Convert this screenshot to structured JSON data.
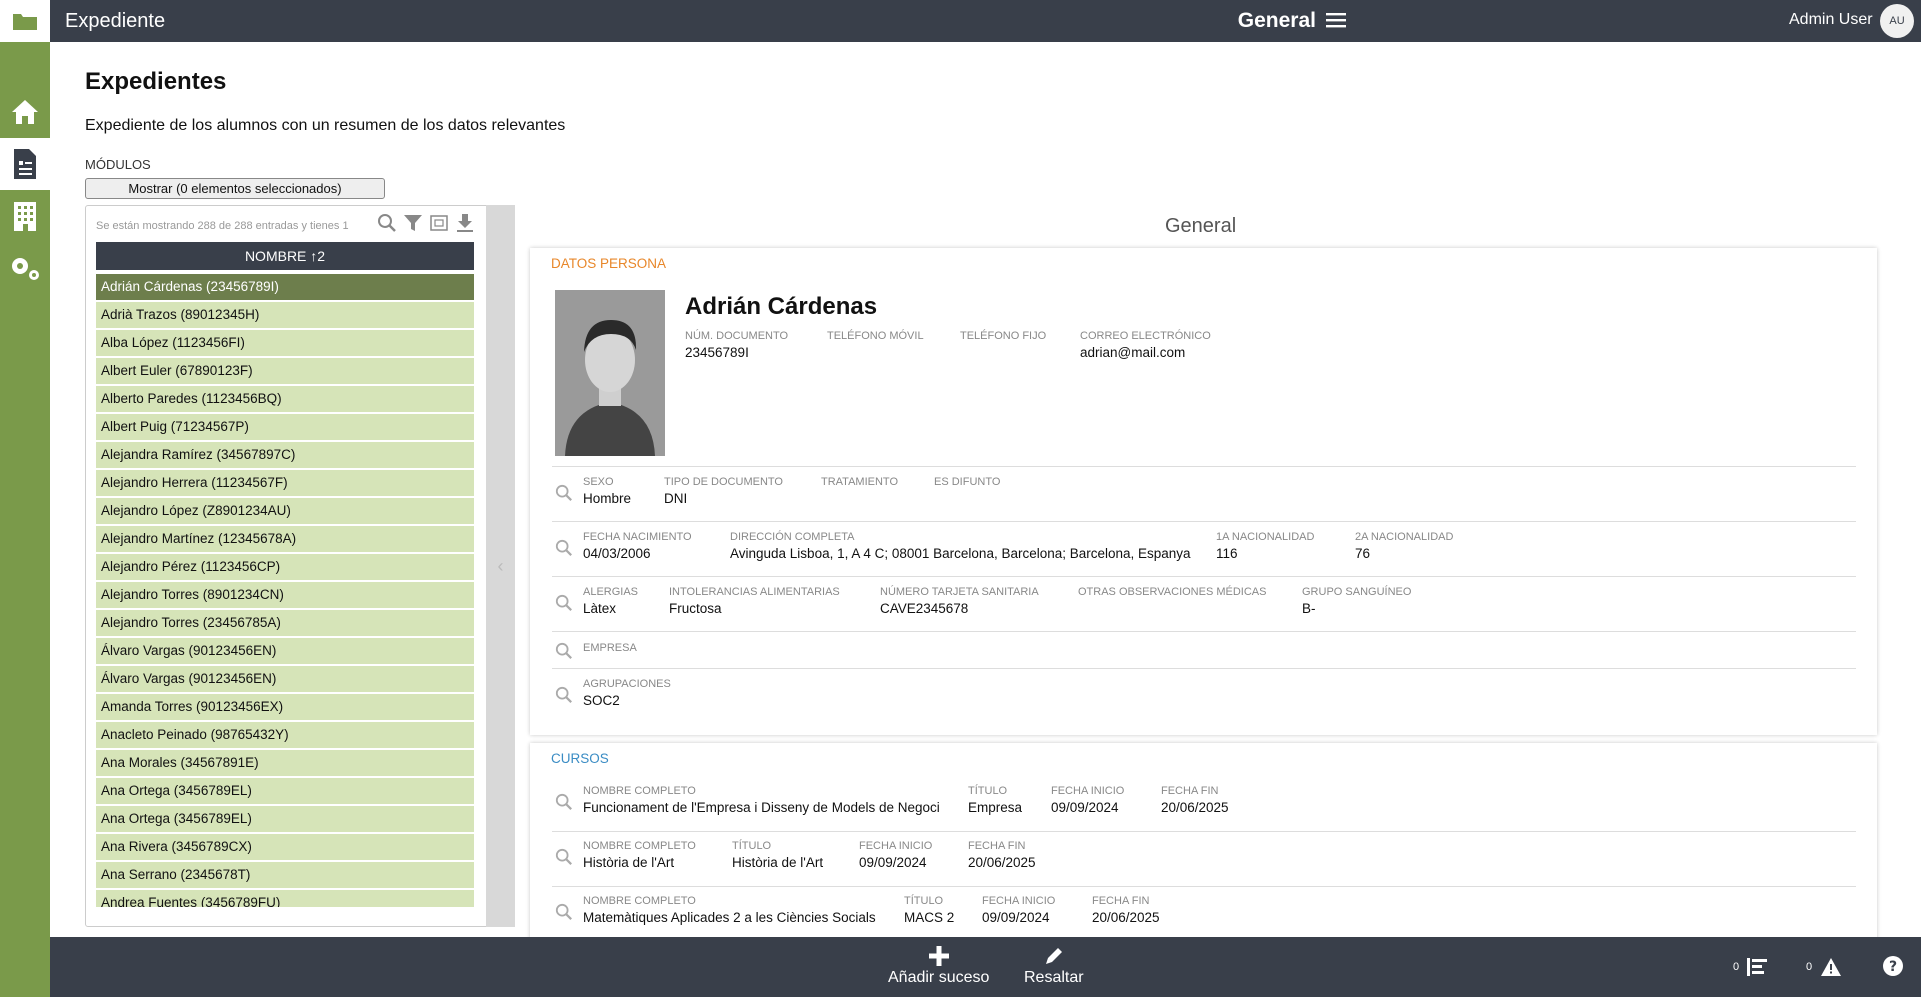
{
  "topbar": {
    "app_title": "Expediente",
    "section": "General",
    "user_name": "Admin User",
    "user_initials": "AU"
  },
  "page": {
    "title": "Expedientes",
    "description": "Expediente de los alumnos con un resumen de los datos relevantes",
    "modules_label": "MÓDULOS",
    "modules_button": "Mostrar (0 elementos seleccionados)"
  },
  "list": {
    "info": "Se están mostrando 288 de 288 entradas y tienes 1",
    "column_header": "NOMBRE ↑2",
    "rows": [
      "Adrián Cárdenas (23456789I)",
      "Adrià Trazos (89012345H)",
      "Alba López (1123456FI)",
      "Albert Euler (67890123F)",
      "Alberto Paredes (1123456BQ)",
      "Albert Puig (71234567P)",
      "Alejandra Ramírez (34567897C)",
      "Alejandro Herrera (11234567F)",
      "Alejandro López (Z8901234AU)",
      "Alejandro Martínez (12345678A)",
      "Alejandro Pérez (1123456CP)",
      "Alejandro Torres (8901234CN)",
      "Alejandro Torres (23456785A)",
      "Álvaro Vargas (90123456EN)",
      "Álvaro Vargas (90123456EN)",
      "Amanda Torres (90123456EX)",
      "Anacleto Peinado (98765432Y)",
      "Ana Morales (34567891E)",
      "Ana Ortega (3456789EL)",
      "Ana Ortega (3456789EL)",
      "Ana Rivera (3456789CX)",
      "Ana Serrano (2345678T)",
      "Andrea Fuentes (3456789FU)"
    ]
  },
  "detail": {
    "title": "General",
    "datos_persona": {
      "section_title": "DATOS PERSONA",
      "name": "Adrián Cárdenas",
      "num_documento_label": "NÚM. DOCUMENTO",
      "num_documento": "23456789I",
      "telefono_movil_label": "TELÉFONO MÓVIL",
      "telefono_fijo_label": "TELÉFONO FIJO",
      "correo_label": "CORREO ELECTRÓNICO",
      "correo": "adrian@mail.com",
      "sexo_label": "SEXO",
      "sexo": "Hombre",
      "tipo_doc_label": "TIPO DE DOCUMENTO",
      "tipo_doc": "DNI",
      "tratamiento_label": "TRATAMIENTO",
      "es_difunto_label": "ES DIFUNTO",
      "fecha_nac_label": "FECHA NACIMIENTO",
      "fecha_nac": "04/03/2006",
      "direccion_label": "DIRECCIÓN COMPLETA",
      "direccion": "Avinguda Lisboa, 1, A 4 C; 08001 Barcelona, Barcelona; Barcelona, Espanya",
      "nac1_label": "1A NACIONALIDAD",
      "nac1": "116",
      "nac2_label": "2A NACIONALIDAD",
      "nac2": "76",
      "alergias_label": "ALERGIAS",
      "alergias": "Làtex",
      "intolerancias_label": "INTOLERANCIAS ALIMENTARIAS",
      "intolerancias": "Fructosa",
      "tarjeta_label": "NÚMERO TARJETA SANITARIA",
      "tarjeta": "CAVE2345678",
      "otras_obs_label": "OTRAS OBSERVACIONES MÉDICAS",
      "grupo_label": "GRUPO SANGUÍNEO",
      "grupo": "B-",
      "empresa_label": "EMPRESA",
      "agrupaciones_label": "AGRUPACIONES",
      "agrupaciones": "SOC2"
    },
    "cursos": {
      "section_title": "CURSOS",
      "nombre_label": "NOMBRE COMPLETO",
      "titulo_label": "TÍTULO",
      "fecha_inicio_label": "FECHA INICIO",
      "fecha_fin_label": "FECHA FIN",
      "items": [
        {
          "nombre": "Funcionament de l'Empresa i Disseny de Models de Negoci",
          "titulo": "Empresa",
          "inicio": "09/09/2024",
          "fin": "20/06/2025"
        },
        {
          "nombre": "Història de l'Art",
          "titulo": "Història de l'Art",
          "inicio": "09/09/2024",
          "fin": "20/06/2025"
        },
        {
          "nombre": "Matemàtiques Aplicades 2 a les Ciències Socials",
          "titulo": "MACS 2",
          "inicio": "09/09/2024",
          "fin": "20/06/2025"
        }
      ]
    }
  },
  "bottombar": {
    "add_event": "Añadir suceso",
    "highlight": "Resaltar",
    "count_list": "0",
    "count_alert": "0"
  },
  "colors": {
    "topbar": "#393f4a",
    "rail": "#7a9a4a",
    "row": "#d6e4b8",
    "row_selected": "#6d7e4c",
    "datos_persona_title": "#e8872a",
    "cursos_title": "#3a8cc4"
  }
}
